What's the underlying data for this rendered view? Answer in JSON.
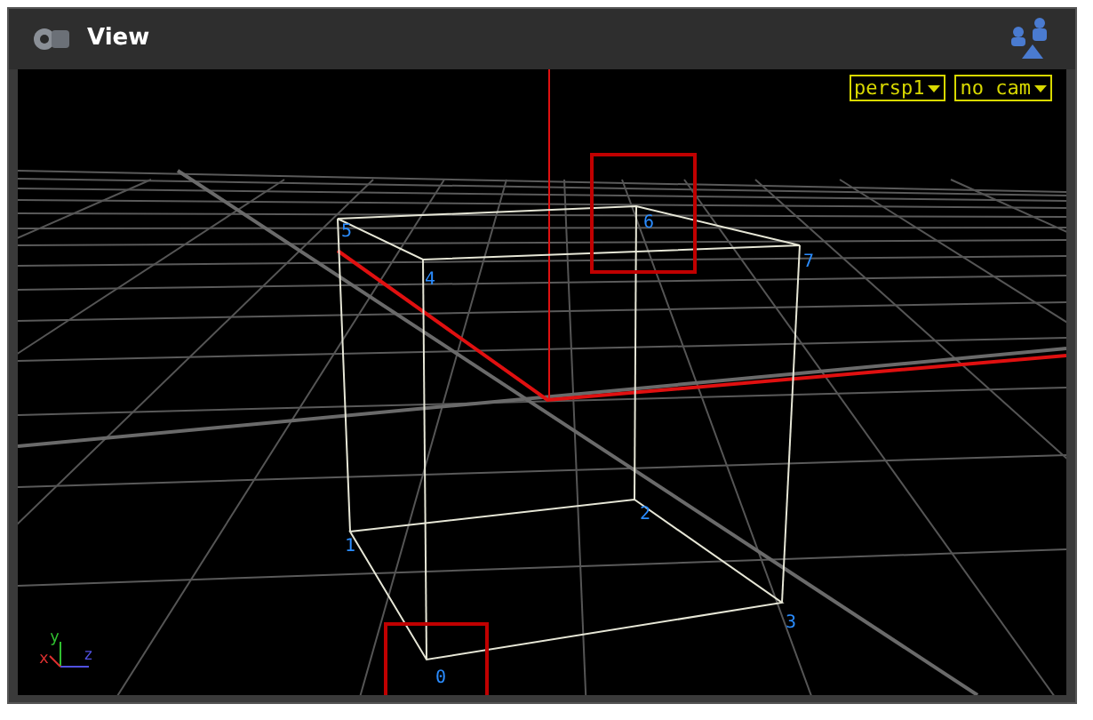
{
  "panel": {
    "title": "View"
  },
  "view_menus": [
    "persp1",
    "no cam"
  ],
  "point_numbers": [
    "0",
    "1",
    "2",
    "3",
    "4",
    "5",
    "6",
    "7"
  ],
  "axis_labels": [
    "x",
    "y",
    "z"
  ]
}
